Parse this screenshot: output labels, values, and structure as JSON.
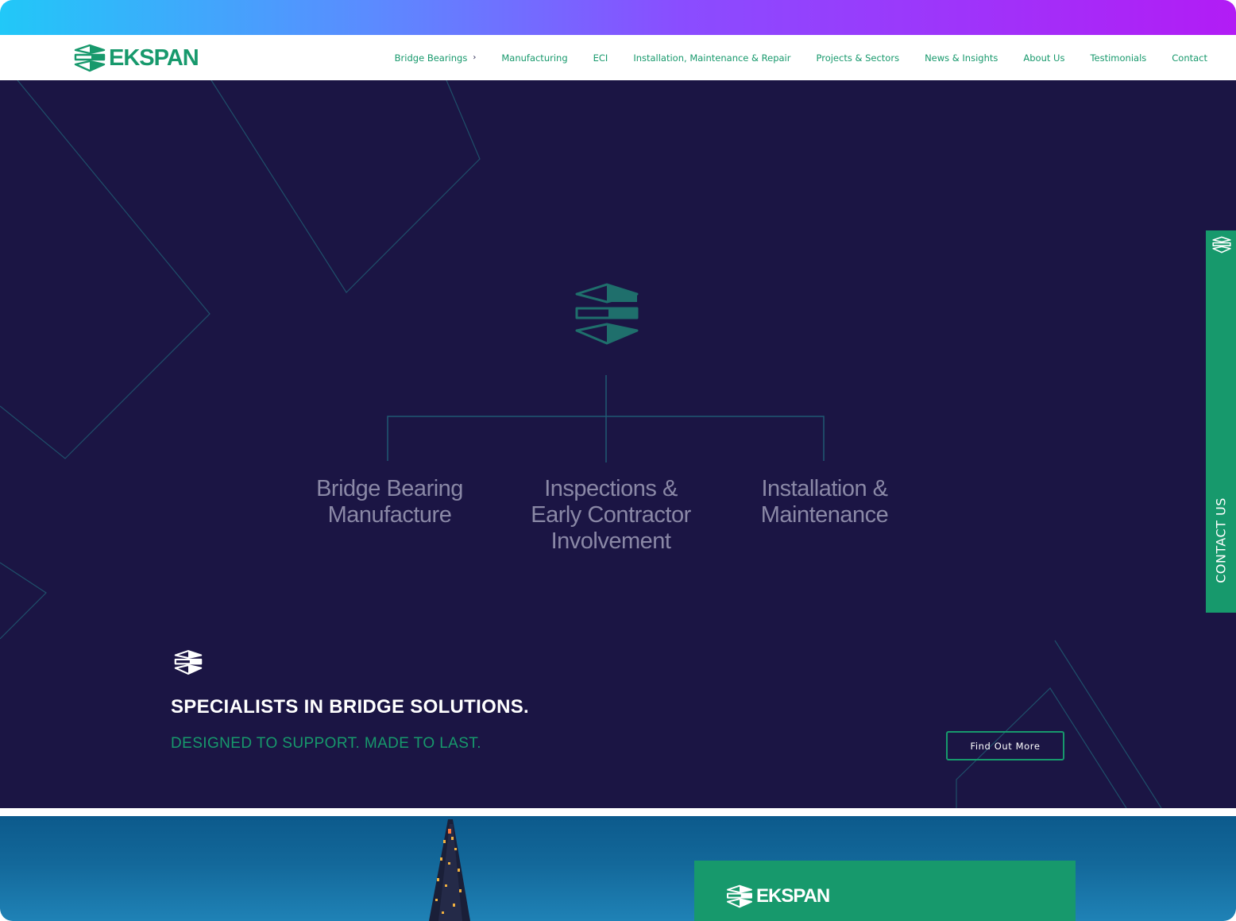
{
  "brand": {
    "name": "EKSPAN",
    "accent_color": "#17996c",
    "navy_color": "#1b1544"
  },
  "nav": {
    "items": [
      {
        "label": "Bridge Bearings",
        "has_dropdown": true
      },
      {
        "label": "Manufacturing"
      },
      {
        "label": "ECI"
      },
      {
        "label": "Installation, Maintenance & Repair"
      },
      {
        "label": "Projects & Sectors"
      },
      {
        "label": "News & Insights"
      },
      {
        "label": "About Us"
      },
      {
        "label": "Testimonials"
      },
      {
        "label": "Contact"
      }
    ]
  },
  "hero": {
    "pillars": [
      {
        "line1": "Bridge Bearing",
        "line2": "Manufacture",
        "line3": ""
      },
      {
        "line1": "Inspections &",
        "line2": "Early Contractor",
        "line3": "Involvement"
      },
      {
        "line1": "Installation &",
        "line2": "Maintenance",
        "line3": ""
      }
    ],
    "title": "SPECIALISTS IN BRIDGE SOLUTIONS.",
    "subtitle": "DESIGNED TO SUPPORT. MADE TO LAST.",
    "cta_label": "Find Out More"
  },
  "contact_tab": {
    "label": "CONTACT US"
  },
  "bottom": {
    "card_logo_text": "EKSPAN"
  }
}
